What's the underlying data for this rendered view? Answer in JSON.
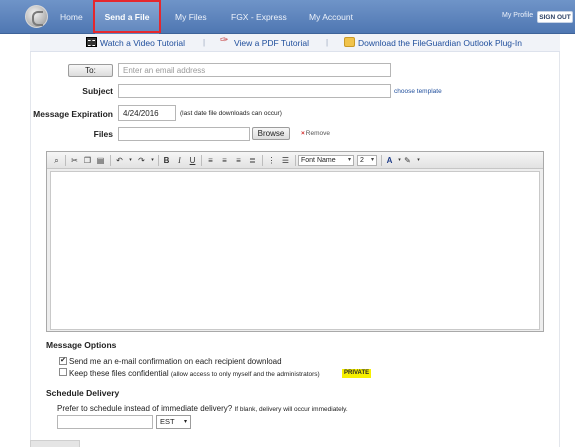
{
  "nav": {
    "items": [
      "Home",
      "Send a File",
      "My Files",
      "FGX - Express",
      "My Account"
    ],
    "my_profile": "My Profile",
    "sign_out": "SIGN OUT"
  },
  "tutorials": {
    "video": "Watch a Video Tutorial",
    "pdf": "View a PDF Tutorial",
    "plugin": "Download the FileGuardian Outlook Plug-In"
  },
  "form": {
    "to_button": "To:",
    "to_placeholder": "Enter an email address",
    "subject_label": "Subject",
    "choose_template": "choose template",
    "expiration_label": "Message Expiration",
    "expiration_value": "4/24/2016",
    "expiration_note": "(last date file downloads can occur)",
    "files_label": "Files",
    "browse_button": "Browse",
    "remove_label": "Remove"
  },
  "editor": {
    "font_name": "Font Name",
    "font_size": "2"
  },
  "options": {
    "title": "Message Options",
    "confirm_label": "Send me an e-mail confirmation on each recipient download",
    "confirm_checked": true,
    "confidential_label": "Keep these files confidential",
    "confidential_note": "(allow access to only myself and the administrators)",
    "confidential_checked": false,
    "private_badge": "PRIVATE"
  },
  "schedule": {
    "title": "Schedule Delivery",
    "prompt": "Prefer to schedule instead of immediate delivery?",
    "note": "If blank, delivery will occur immediately.",
    "timezone": "EST"
  }
}
